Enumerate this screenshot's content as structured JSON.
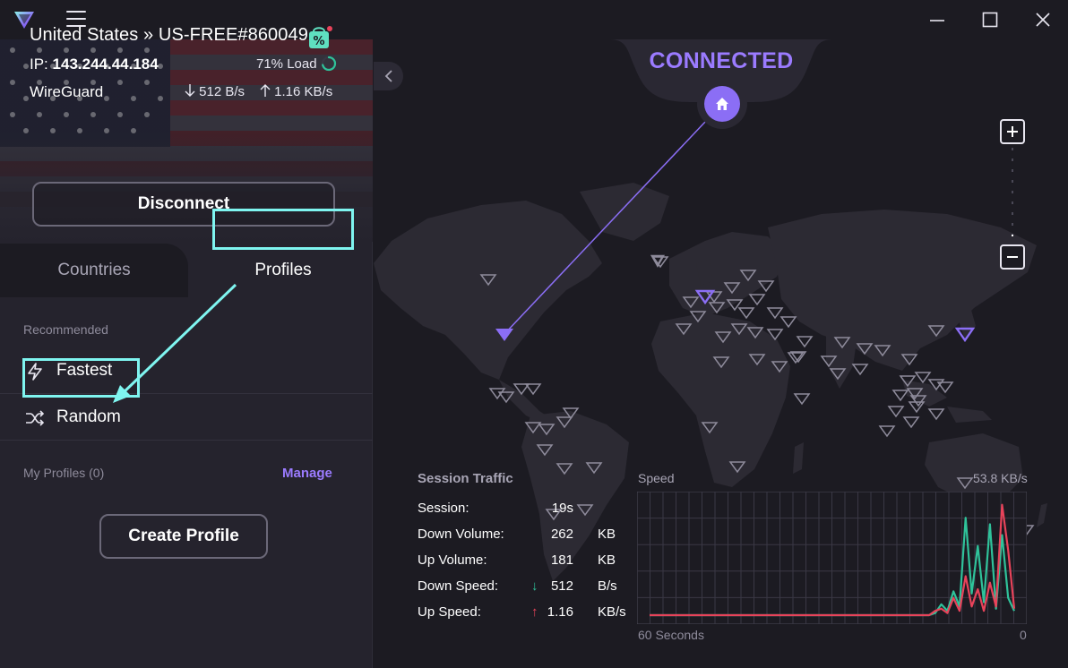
{
  "titlebar": {
    "logo_icon": "protonvpn-logo-icon",
    "menu_icon": "hamburger-menu-icon",
    "window_controls": [
      "minimize-icon",
      "maximize-icon",
      "close-icon"
    ]
  },
  "connection": {
    "server": "United States » US-FREE#860049",
    "ip_label": "IP:",
    "ip": "143.244.44.184",
    "load": "71% Load",
    "load_percent": 71,
    "protocol": "WireGuard",
    "down_rate": "512 B/s",
    "up_rate": "1.16 KB/s",
    "disconnect_label": "Disconnect",
    "promo_icon": "discount-tag-icon"
  },
  "tabs": {
    "countries": "Countries",
    "profiles": "Profiles",
    "active": "profiles"
  },
  "profiles": {
    "recommended_label": "Recommended",
    "fastest": "Fastest",
    "random": "Random",
    "my_profiles_label": "My Profiles (0)",
    "manage": "Manage",
    "create_profile": "Create Profile"
  },
  "map": {
    "status": "CONNECTED",
    "home_icon": "home-icon",
    "zoom_in": "+",
    "zoom_out": "−"
  },
  "session_traffic": {
    "title": "Session Traffic",
    "rows": [
      {
        "key": "Session:",
        "value": "19s",
        "unit": ""
      },
      {
        "key": "Down Volume:",
        "value": "262",
        "unit": "KB"
      },
      {
        "key": "Up Volume:",
        "value": "181",
        "unit": "KB"
      },
      {
        "key": "Down Speed:",
        "value": "512",
        "unit": "B/s",
        "arrow": "↓"
      },
      {
        "key": "Up Speed:",
        "value": "1.16",
        "unit": "KB/s",
        "arrow": "↑"
      }
    ]
  },
  "speed": {
    "label": "Speed",
    "max_label": "53.8  KB/s",
    "axis_left": "60 Seconds",
    "axis_right": "0",
    "colors": {
      "down": "#2fc29a",
      "up": "#e8435a"
    }
  },
  "chart_data": {
    "type": "line",
    "title": "Speed",
    "xlabel": "",
    "ylabel": "",
    "ylim": [
      0,
      53.8
    ],
    "x": [
      60,
      58,
      56,
      54,
      52,
      50,
      48,
      46,
      44,
      42,
      40,
      38,
      36,
      34,
      32,
      30,
      28,
      26,
      24,
      22,
      20,
      18,
      16,
      14,
      13,
      12,
      11,
      10,
      9,
      8,
      7,
      6,
      5,
      4,
      3,
      2,
      1,
      0
    ],
    "series": [
      {
        "name": "Down",
        "values": [
          0,
          0,
          0,
          0,
          0,
          0,
          0,
          0,
          0,
          0,
          0,
          0,
          0,
          0,
          0,
          0,
          0,
          0,
          0,
          0,
          0,
          0,
          0,
          0,
          1,
          5,
          2,
          11,
          4,
          45,
          10,
          32,
          6,
          42,
          3,
          37,
          8,
          2
        ]
      },
      {
        "name": "Up",
        "values": [
          0,
          0,
          0,
          0,
          0,
          0,
          0,
          0,
          0,
          0,
          0,
          0,
          0,
          0,
          0,
          0,
          0,
          0,
          0,
          0,
          0,
          0,
          0,
          0,
          2,
          3,
          1,
          8,
          2,
          18,
          4,
          12,
          2,
          15,
          4,
          51,
          30,
          3
        ]
      }
    ]
  }
}
